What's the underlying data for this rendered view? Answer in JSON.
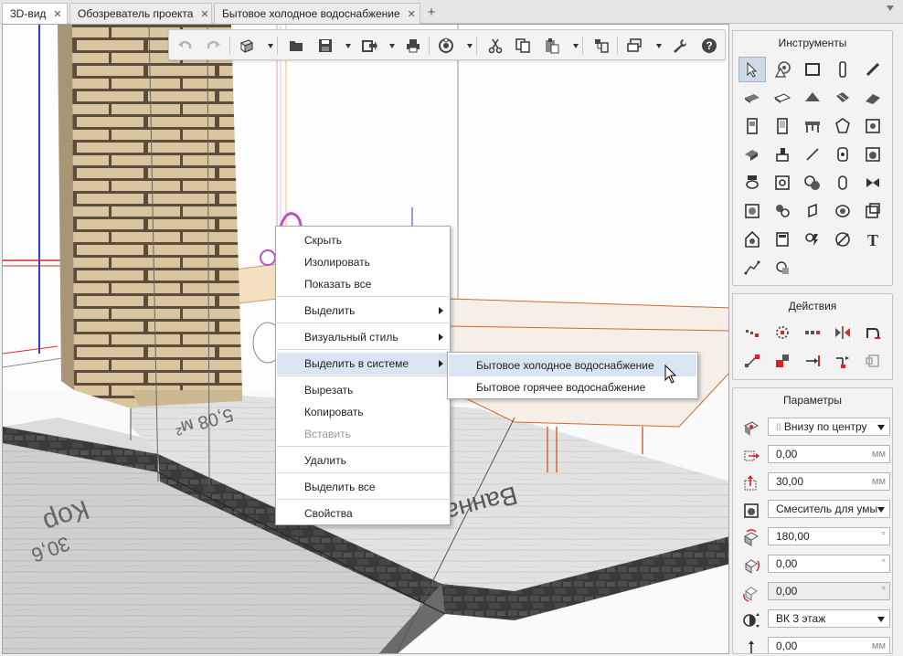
{
  "tabs": [
    {
      "label": "3D-вид",
      "active": true
    },
    {
      "label": "Обозреватель проекта",
      "active": false
    },
    {
      "label": "Бытовое холодное водоснабжение",
      "active": false
    }
  ],
  "toolbar": {
    "buttons": [
      "undo-icon",
      "redo-icon",
      "view-cube-icon",
      "folder-icon",
      "save-icon",
      "export-icon",
      "print-icon",
      "render-icon",
      "scissors-icon",
      "copy-icon",
      "paste-icon",
      "layers-icon",
      "views-icon",
      "wrench-icon",
      "help-icon"
    ]
  },
  "context_menu": {
    "items": [
      {
        "label": "Скрыть"
      },
      {
        "label": "Изолировать"
      },
      {
        "label": "Показать все"
      },
      {
        "label": "Выделить",
        "submenu": true
      },
      {
        "label": "Визуальный стиль",
        "submenu": true
      },
      {
        "label": "Выделить в системе",
        "submenu": true,
        "highlighted": true
      },
      {
        "label": "Вырезать"
      },
      {
        "label": "Копировать"
      },
      {
        "label": "Вставить",
        "disabled": true
      },
      {
        "label": "Удалить"
      },
      {
        "label": "Выделить все"
      },
      {
        "label": "Свойства"
      }
    ],
    "submenu": [
      {
        "label": "Бытовое холодное водоснабжение",
        "highlighted": true
      },
      {
        "label": "Бытовое горячее водоснабжение"
      }
    ]
  },
  "tools_panel": {
    "title": "Инструменты"
  },
  "actions_panel": {
    "title": "Действия"
  },
  "params_panel": {
    "title": "Параметры",
    "rows": [
      {
        "icon": "anchor-icon",
        "value": "Внизу по центру",
        "type": "select"
      },
      {
        "icon": "offset-x-icon",
        "value": "0,00",
        "unit": "мм"
      },
      {
        "icon": "offset-z-icon",
        "value": "30,00",
        "unit": "мм"
      },
      {
        "icon": "fixture-icon",
        "value": "Смеситель для умы",
        "type": "select"
      },
      {
        "icon": "rotate-z-icon",
        "value": "180,00",
        "unit": "°"
      },
      {
        "icon": "rotate-y-icon",
        "value": "0,00",
        "unit": "°"
      },
      {
        "icon": "rotate-x-icon",
        "value": "0,00",
        "unit": "°",
        "readonly": true
      },
      {
        "icon": "system-icon",
        "value": "ВК 3 этаж",
        "type": "select"
      },
      {
        "icon": "height-icon",
        "value": "0,00",
        "unit": "мм"
      }
    ]
  },
  "scene": {
    "floor_labels": [
      "Ванная",
      "5,08 м²",
      "Кор",
      "30,6"
    ]
  }
}
